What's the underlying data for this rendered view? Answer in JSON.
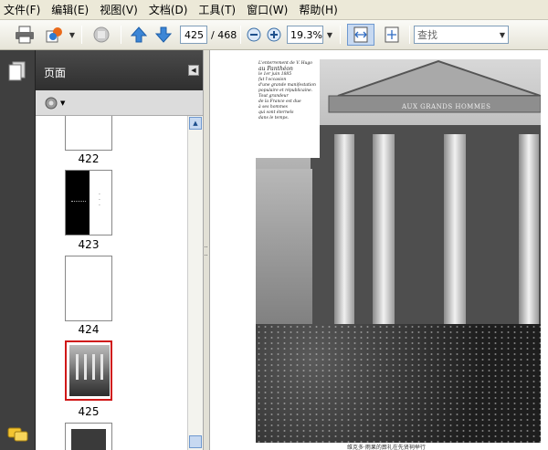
{
  "menu": [
    "文件(F)",
    "编辑(E)",
    "视图(V)",
    "文档(D)",
    "工具(T)",
    "窗口(W)",
    "帮助(H)"
  ],
  "toolbar": {
    "current_page": "425",
    "total_pages": "/ 468",
    "zoom": "19.3%",
    "search_placeholder": "查找"
  },
  "sidebar": {
    "title": "页面",
    "thumbnails": [
      {
        "label": "422",
        "selected": false
      },
      {
        "label": "423",
        "selected": false
      },
      {
        "label": "424",
        "selected": false
      },
      {
        "label": "425",
        "selected": true
      }
    ]
  },
  "document": {
    "inscription": [
      "L'enterrement de V. Hugo",
      "au Panthéon",
      "le 1er juin 1885",
      "fut l'occasion",
      "d'une grande manifestation",
      "populaire et républicaine.",
      "Tout grandeur",
      "de la France est due",
      "à ses hommes",
      "qui sont éternels",
      "dans le temps."
    ],
    "pediment_text": "AUX GRANDS HOMMES",
    "caption": "维克多·雨果的葬礼在先贤祠举行"
  },
  "colors": {
    "accent": "#3a6ea5",
    "selection": "#d01818"
  }
}
